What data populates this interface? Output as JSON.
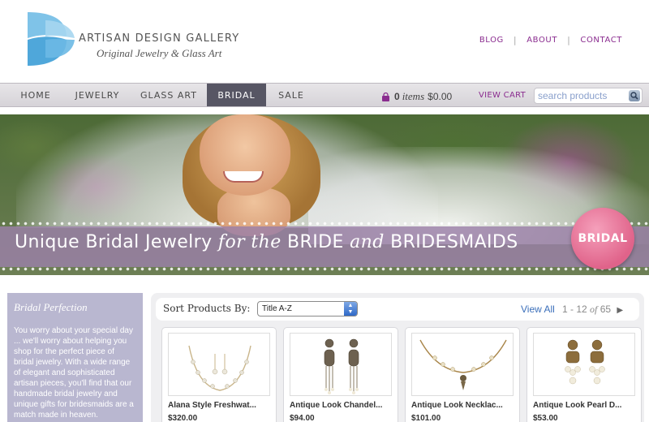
{
  "header": {
    "logo_title": "ARTISAN DESIGN GALLERY",
    "logo_subtitle": "Original Jewelry & Glass Art",
    "top_links": [
      "BLOG",
      "ABOUT",
      "CONTACT"
    ]
  },
  "nav": {
    "items": [
      "HOME",
      "JEWELRY",
      "GLASS ART",
      "BRIDAL",
      "SALE"
    ],
    "active": "BRIDAL",
    "cart_count": "0",
    "cart_items_label": "items",
    "cart_total": "$0.00",
    "view_cart": "VIEW CART",
    "search_placeholder": "search products"
  },
  "hero": {
    "text_part1": "Unique Bridal Jewelry ",
    "text_italic1": "for the",
    "text_part2": " BRIDE ",
    "text_italic2": "and",
    "text_part3": " BRIDESMAIDS",
    "badge": "BRIDAL"
  },
  "sidebar": {
    "title": "Bridal Perfection",
    "body": "You worry about your special day ... we'll worry about helping you shop for the perfect piece of bridal jewelry. With a wide range of elegant and sophisticated artisan pieces, you'll find that our handmade bridal jewelry and unique gifts for bridesmaids are a match made in heaven."
  },
  "sortbar": {
    "label": "Sort Products By:",
    "selected": "Title A-Z",
    "view_all": "View All",
    "range": "1 - 12",
    "of": "of",
    "total": "65",
    "next_icon": "▶"
  },
  "products": [
    {
      "name": "Alana Style Freshwat...",
      "price": "$320.00",
      "icon": "necklace-set-icon"
    },
    {
      "name": "Antique Look Chandel...",
      "price": "$94.00",
      "icon": "chandelier-earrings-icon"
    },
    {
      "name": "Antique Look Necklac...",
      "price": "$101.00",
      "icon": "necklace-icon"
    },
    {
      "name": "Antique Look Pearl D...",
      "price": "$53.00",
      "icon": "pearl-earrings-icon"
    }
  ],
  "colors": {
    "link_purple": "#8a2c8f",
    "nav_active": "#575664",
    "sidebar_bg": "#b9b7d0",
    "badge_pink": "#e0638a"
  }
}
